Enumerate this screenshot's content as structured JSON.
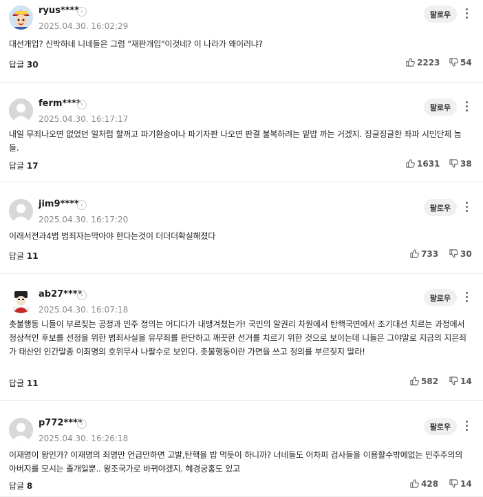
{
  "follow_label": "팔로우",
  "comments": [
    {
      "username": "ryus****",
      "date": "2025.04.30. 16:02:29",
      "body": "대선개입? 신박하네 니네들은 그럼 \"재판개입\"이것네? 이 나라가 왜이러냐?",
      "reply_label": "답글",
      "reply_count": "30",
      "likes": "2223",
      "dislikes": "54",
      "avatar": "cartoon-avatar"
    },
    {
      "username": "ferm****",
      "date": "2025.04.30. 16:17:17",
      "body": "내일 무죄나오면 없었던 일처럼 할꺼고 파기환송이나 파기자판 나오면 판결 불복하려는 밑밥 까는 거겠지. 징글징글한 좌파 시민단체 놈들.",
      "reply_label": "답글",
      "reply_count": "17",
      "likes": "1631",
      "dislikes": "38",
      "avatar": "default-avatar"
    },
    {
      "username": "jim9****",
      "date": "2025.04.30. 16:17:20",
      "body": "이래서전과4범 범죄자는막아야 한다는것이 더더더확실해졌다",
      "reply_label": "답글",
      "reply_count": "11",
      "likes": "733",
      "dislikes": "30",
      "avatar": "default-avatar"
    },
    {
      "username": "ab27****",
      "date": "2025.04.30. 16:07:18",
      "body": "촛불행동 니들이 부르짖는 공정과 민주 정의는 어디다가 내팽겨쳤는가! 국민의 알권리 차원에서 탄핵국면에서 조기대선 치르는 과정에서 정상적인 후보를 선정을 위한 범죄사실을 유무죄를 판단하고 깨끗한 선거를 치르기 위한 것으로 보이는데 니들은 그야말로 지금의 지은죄가 태산인 인간말종 이죄명의 호위무사 나팔수로 보인다. 촛불행동이란 가면을 쓰고 정의를 부르짖지 말라!",
      "reply_label": "답글",
      "reply_count": "11",
      "likes": "582",
      "dislikes": "14",
      "avatar": "character-avatar"
    },
    {
      "username": "p772****",
      "date": "2025.04.30. 16:26:18",
      "body": "이재명이 왕인가? 이재명의 죄명만 언급만하면 고발,탄핵을 밥 먹듯이 하니까? 너네들도 어차피 검사들을 이용할수밖에없는 민주주의의 아버지를 모시는 졸개일뿐.. 왕조국가로 바뀌야겠지. 혜경궁홍도 있고",
      "reply_label": "답글",
      "reply_count": "8",
      "likes": "428",
      "dislikes": "14",
      "avatar": "default-avatar"
    }
  ]
}
